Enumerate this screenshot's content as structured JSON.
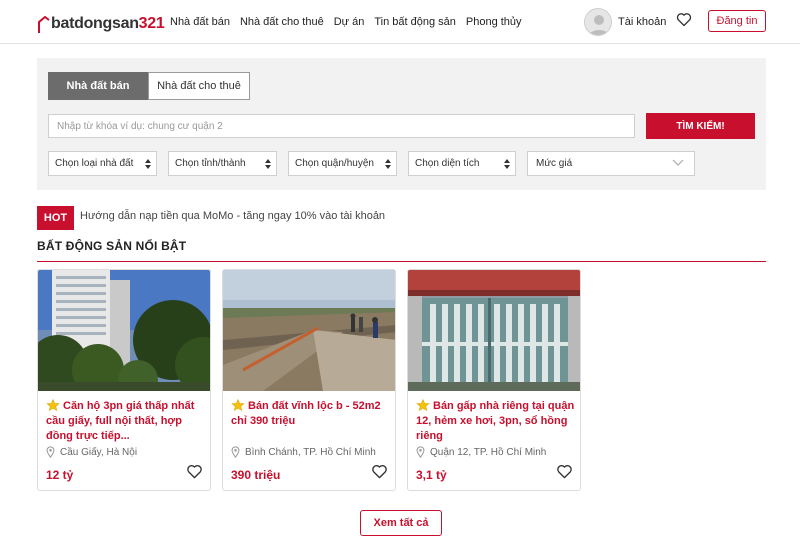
{
  "header": {
    "logo": {
      "text": "batdongsan",
      "number": "321"
    },
    "nav": [
      "Nhà đất bán",
      "Nhà đất cho thuê",
      "Dự án",
      "Tin bất động sản",
      "Phong thủy"
    ],
    "account_label": "Tài khoản",
    "post_button": "Đăng tin"
  },
  "search": {
    "tabs": [
      {
        "label": "Nhà đất bán",
        "active": true
      },
      {
        "label": "Nhà đất cho thuê",
        "active": false
      }
    ],
    "keyword_placeholder": "Nhập từ khóa ví dụ: chung cư quận 2",
    "search_button": "TÌM KIẾM!",
    "filters": [
      "Chọn loại nhà đất",
      "Chọn tỉnh/thành",
      "Chọn quận/huyện",
      "Chọn diện tích",
      "Mức giá"
    ]
  },
  "hot": {
    "badge": "HOT",
    "text": "Hướng dẫn nạp tiền qua MoMo - tăng ngay 10% vào tài khoản"
  },
  "featured": {
    "title": "BẤT ĐỘNG SẢN NỔI BẬT",
    "listings": [
      {
        "title": "Căn hộ 3pn giá thấp nhất cầu giấy, full nội thất, hợp đồng trực tiếp...",
        "location": "Cầu Giấy, Hà Nội",
        "price": "12 tỷ"
      },
      {
        "title": "Bán đất vĩnh lộc b - 52m2 chỉ 390 triệu",
        "location": "Bình Chánh, TP. Hồ Chí Minh",
        "price": "390 triệu"
      },
      {
        "title": "Bán gấp nhà riêng tại quận 12, hẻm xe hơi, 3pn, sổ hồng riêng",
        "location": "Quận 12, TP. Hồ Chí Minh",
        "price": "3,1 tỷ"
      }
    ],
    "view_all": "Xem tất cả"
  },
  "colors": {
    "brand": "#c8102e",
    "panel": "#f2f2f2",
    "tab_active": "#6c6c6c"
  }
}
